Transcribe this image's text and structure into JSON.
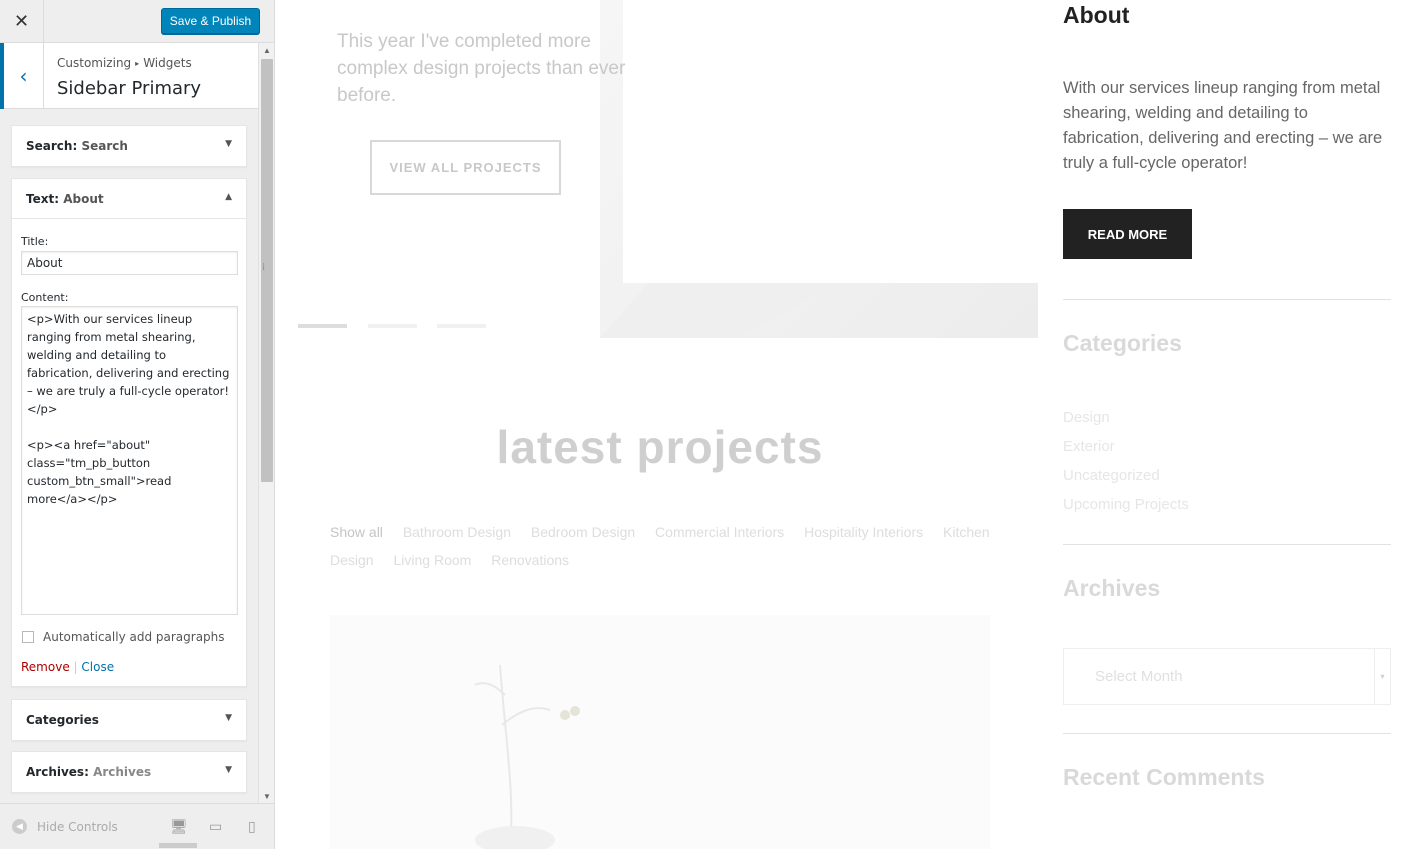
{
  "panel": {
    "close_glyph": "✕",
    "publish_label": "Save & Publish",
    "back_glyph": "‹",
    "breadcrumb": {
      "root": "Customizing",
      "separator": "▸",
      "current": "Widgets"
    },
    "section_title": "Sidebar Primary",
    "resize_glyph": "⁞"
  },
  "widgets": {
    "search": {
      "type": "Search",
      "title": "Search",
      "arrow": "▼"
    },
    "text": {
      "type": "Text",
      "title": "About",
      "arrow": "▲",
      "title_label": "Title:",
      "title_value": "About",
      "content_label": "Content:",
      "content_value": "<p>With our services lineup ranging from metal shearing, welding and detailing to fabrication, delivering and erecting – we are truly a full-cycle operator!</p>\n\n<p><a href=\"about\" class=\"tm_pb_button custom_btn_small\">read more</a></p>",
      "autop_label": "Automatically add paragraphs",
      "remove_label": "Remove",
      "action_separator": "|",
      "close_label": "Close"
    },
    "categories": {
      "type": "Categories",
      "arrow": "▼"
    },
    "archives": {
      "type": "Archives",
      "title": "Archives",
      "arrow": "▼"
    }
  },
  "footer": {
    "hide_controls_label": "Hide Controls",
    "hide_icon_glyph": "◀",
    "devices": [
      "desktop-icon",
      "tablet-icon",
      "mobile-icon"
    ],
    "device_glyphs": {
      "desktop": "🖥",
      "tablet": "▭",
      "mobile": "▯"
    }
  },
  "preview": {
    "slide_text": "This year I've completed more complex design projects than ever before.",
    "view_projects_label": "VIEW ALL PROJECTS",
    "latest_title": "latest projects",
    "filters": [
      "Show all",
      "Bathroom Design",
      "Bedroom Design",
      "Commercial Interiors",
      "Hospitality Interiors",
      "Kitchen Design",
      "Living Room",
      "Renovations"
    ],
    "sidebar": {
      "about_title": "About",
      "about_text": "With our services lineup ranging from metal shearing, welding and detailing to fabrication, delivering and erecting – we are truly a full-cycle operator!",
      "read_more_label": "READ MORE",
      "categories_title": "Categories",
      "categories": [
        "Design",
        "Exterior",
        "Uncategorized",
        "Upcoming Projects"
      ],
      "archives_title": "Archives",
      "month_placeholder": "Select Month",
      "month_arrow": "▾",
      "recent_comments_title": "Recent Comments"
    }
  },
  "colors": {
    "accent": "#0085ba",
    "link": "#0073aa",
    "remove": "#aa0000",
    "dark_button": "#222222"
  }
}
